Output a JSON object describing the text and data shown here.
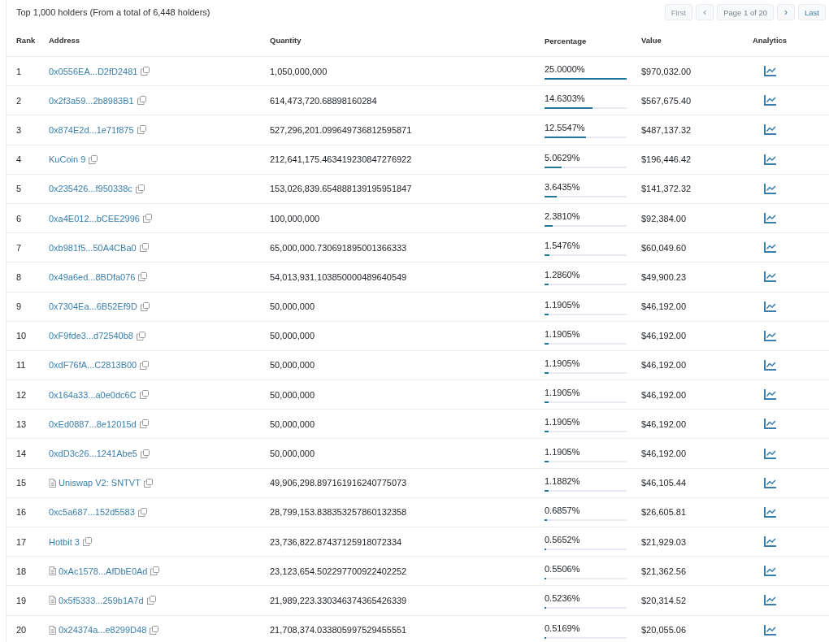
{
  "summary": "Top 1,000 holders (From a total of 6,448 holders)",
  "pagination": [
    {
      "label": "First",
      "kind": "text",
      "disabled": true
    },
    {
      "label": "‹",
      "kind": "arrow",
      "disabled": true
    },
    {
      "label": "Page 1 of 20",
      "kind": "info"
    },
    {
      "label": "›",
      "kind": "arrow",
      "disabled": false
    },
    {
      "label": "Last",
      "kind": "text",
      "disabled": false
    }
  ],
  "table": {
    "columns": [
      "Rank",
      "Address",
      "Quantity",
      "Percentage",
      "Value",
      "Analytics"
    ],
    "rows": [
      {
        "rank": "1",
        "address": "0x0556EA...D2fD2481",
        "contract": false,
        "quantity": "1,050,000,000",
        "percentage": "25.0000%",
        "level": 1,
        "value": "$970,032.00"
      },
      {
        "rank": "2",
        "address": "0x2f3a59...2b8983B1",
        "contract": false,
        "quantity": "614,473,720.68898160284",
        "percentage": "14.6303%",
        "level": 0.585,
        "value": "$567,675.40"
      },
      {
        "rank": "3",
        "address": "0x874E2d...1e71f875",
        "contract": false,
        "quantity": "527,296,201.099649736812595871",
        "percentage": "12.5547%",
        "level": 0.502,
        "value": "$487,137.32"
      },
      {
        "rank": "4",
        "address": "KuCoin 9",
        "contract": false,
        "quantity": "212,641,175.463419230847276922",
        "percentage": "5.0629%",
        "level": 0.203,
        "value": "$196,446.42"
      },
      {
        "rank": "5",
        "address": "0x235426...f950338c",
        "contract": false,
        "quantity": "153,026,839.654888139195951847",
        "percentage": "3.6435%",
        "level": 0.146,
        "value": "$141,372.32"
      },
      {
        "rank": "6",
        "address": "0xa4E012...bCEE2996",
        "contract": false,
        "quantity": "100,000,000",
        "percentage": "2.3810%",
        "level": 0.095,
        "value": "$92,384.00"
      },
      {
        "rank": "7",
        "address": "0xb981f5...50A4CBa0",
        "contract": false,
        "quantity": "65,000,000.730691895001366333",
        "percentage": "1.5476%",
        "level": 0.062,
        "value": "$60,049.60"
      },
      {
        "rank": "8",
        "address": "0x49a6ed...8BDfa076",
        "contract": false,
        "quantity": "54,013,931.103850000489640549",
        "percentage": "1.2860%",
        "level": 0.051,
        "value": "$49,900.23"
      },
      {
        "rank": "9",
        "address": "0x7304Ea...6B52Ef9D",
        "contract": false,
        "quantity": "50,000,000",
        "percentage": "1.1905%",
        "level": 0.048,
        "value": "$46,192.00"
      },
      {
        "rank": "10",
        "address": "0xF9fde3...d72540b8",
        "contract": false,
        "quantity": "50,000,000",
        "percentage": "1.1905%",
        "level": 0.048,
        "value": "$46,192.00"
      },
      {
        "rank": "11",
        "address": "0xdF76fA...C2813B00",
        "contract": false,
        "quantity": "50,000,000",
        "percentage": "1.1905%",
        "level": 0.048,
        "value": "$46,192.00"
      },
      {
        "rank": "12",
        "address": "0x164a33...a0e0dc6C",
        "contract": false,
        "quantity": "50,000,000",
        "percentage": "1.1905%",
        "level": 0.048,
        "value": "$46,192.00"
      },
      {
        "rank": "13",
        "address": "0xEd0887...8e12015d",
        "contract": false,
        "quantity": "50,000,000",
        "percentage": "1.1905%",
        "level": 0.048,
        "value": "$46,192.00"
      },
      {
        "rank": "14",
        "address": "0xdD3c26...1241Abe5",
        "contract": false,
        "quantity": "50,000,000",
        "percentage": "1.1905%",
        "level": 0.048,
        "value": "$46,192.00"
      },
      {
        "rank": "15",
        "address": "Uniswap V2: SNTVT",
        "contract": true,
        "quantity": "49,906,298.897161916240775073",
        "percentage": "1.1882%",
        "level": 0.048,
        "value": "$46,105.44"
      },
      {
        "rank": "16",
        "address": "0xc5a687...152d5583",
        "contract": false,
        "quantity": "28,799,153.838353257860132358",
        "percentage": "0.6857%",
        "level": 0.027,
        "value": "$26,605.81"
      },
      {
        "rank": "17",
        "address": "Hotbit 3",
        "contract": false,
        "quantity": "23,736,822.87437125918072334",
        "percentage": "0.5652%",
        "level": 0.023,
        "value": "$21,929.03"
      },
      {
        "rank": "18",
        "address": "0xAc1578...AfDbE0Ad",
        "contract": true,
        "quantity": "23,123,654.502297700922402252",
        "percentage": "0.5506%",
        "level": 0.022,
        "value": "$21,362.56"
      },
      {
        "rank": "19",
        "address": "0x5f5333...259b1A7d",
        "contract": true,
        "quantity": "21,989,223.330346374365426339",
        "percentage": "0.5236%",
        "level": 0.021,
        "value": "$20,314.52"
      },
      {
        "rank": "20",
        "address": "0x24374a...e8299D48",
        "contract": true,
        "quantity": "21,708,374.033805997529455551",
        "percentage": "0.5169%",
        "level": 0.021,
        "value": "$20,055.06"
      }
    ]
  }
}
